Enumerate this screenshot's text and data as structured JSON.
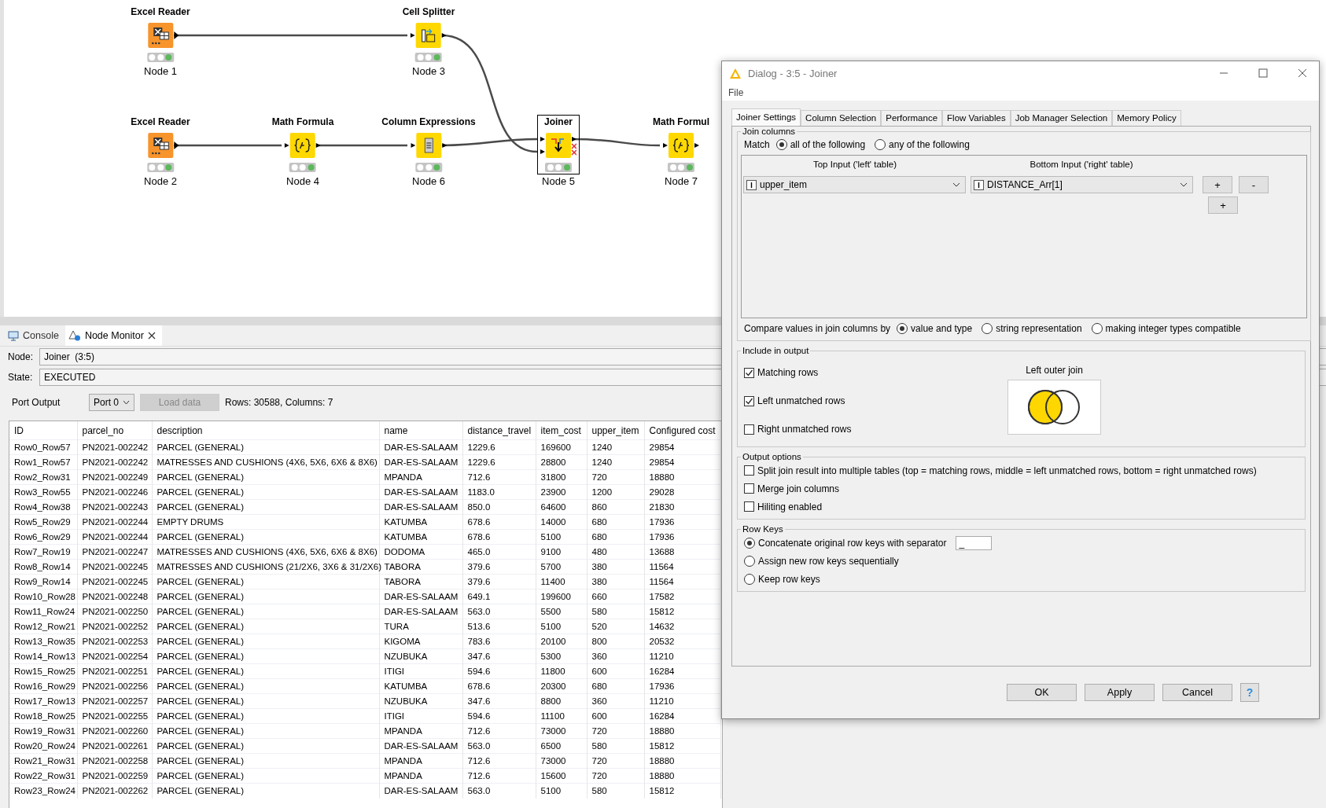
{
  "workflow": {
    "nodes": [
      {
        "title": "Excel Reader",
        "label": "Node 1",
        "kind": "excel",
        "executed": true,
        "selected": false
      },
      {
        "title": "Cell Splitter",
        "label": "Node 3",
        "kind": "splitter",
        "executed": true,
        "selected": false
      },
      {
        "title": "Excel Reader",
        "label": "Node 2",
        "kind": "excel",
        "executed": true,
        "selected": false
      },
      {
        "title": "Math Formula",
        "label": "Node 4",
        "kind": "math",
        "executed": true,
        "selected": false
      },
      {
        "title": "Column Expressions",
        "label": "Node 6",
        "kind": "expr",
        "executed": true,
        "selected": false
      },
      {
        "title": "Joiner",
        "label": "Node 5",
        "kind": "joiner",
        "executed": true,
        "selected": true
      },
      {
        "title": "Math Formul",
        "label": "Node 7",
        "kind": "math",
        "executed": true,
        "selected": false
      }
    ]
  },
  "monitor": {
    "tabs": [
      {
        "label": "Console",
        "kind": "console",
        "selected": false
      },
      {
        "label": "Node Monitor",
        "kind": "monitor",
        "selected": true
      }
    ],
    "node_label": "Node:",
    "node_value": "Joiner  (3:5)",
    "state_label": "State:",
    "state_value": "EXECUTED",
    "port_label": "Port Output",
    "port_select": "Port 0",
    "load_button": {
      "label": "Load data",
      "disabled": true
    },
    "summary": "Rows: 30588, Columns: 7",
    "table": {
      "columns": [
        "ID",
        "parcel_no",
        "description",
        "name",
        "distance_travel",
        "item_cost",
        "upper_item",
        "Configured cost"
      ],
      "rows": [
        [
          "Row0_Row57",
          "PN2021-002242",
          "PARCEL (GENERAL)",
          "DAR-ES-SALAAM",
          "1229.6",
          "169600",
          "1240",
          "29854"
        ],
        [
          "Row1_Row57",
          "PN2021-002242",
          "MATRESSES AND CUSHIONS (4X6, 5X6, 6X6 & 8X6)",
          "DAR-ES-SALAAM",
          "1229.6",
          "28800",
          "1240",
          "29854"
        ],
        [
          "Row2_Row31",
          "PN2021-002249",
          "PARCEL (GENERAL)",
          "MPANDA",
          "712.6",
          "31800",
          "720",
          "18880"
        ],
        [
          "Row3_Row55",
          "PN2021-002246",
          "PARCEL (GENERAL)",
          "DAR-ES-SALAAM",
          "1183.0",
          "23900",
          "1200",
          "29028"
        ],
        [
          "Row4_Row38",
          "PN2021-002243",
          "PARCEL (GENERAL)",
          "DAR-ES-SALAAM",
          "850.0",
          "64600",
          "860",
          "21830"
        ],
        [
          "Row5_Row29",
          "PN2021-002244",
          "EMPTY DRUMS",
          "KATUMBA",
          "678.6",
          "14000",
          "680",
          "17936"
        ],
        [
          "Row6_Row29",
          "PN2021-002244",
          "PARCEL (GENERAL)",
          "KATUMBA",
          "678.6",
          "5100",
          "680",
          "17936"
        ],
        [
          "Row7_Row19",
          "PN2021-002247",
          "MATRESSES AND CUSHIONS (4X6, 5X6, 6X6 & 8X6)",
          "DODOMA",
          "465.0",
          "9100",
          "480",
          "13688"
        ],
        [
          "Row8_Row14",
          "PN2021-002245",
          "MATRESSES AND CUSHIONS (21/2X6, 3X6 & 31/2X6)",
          "TABORA",
          "379.6",
          "5700",
          "380",
          "11564"
        ],
        [
          "Row9_Row14",
          "PN2021-002245",
          "PARCEL (GENERAL)",
          "TABORA",
          "379.6",
          "11400",
          "380",
          "11564"
        ],
        [
          "Row10_Row28",
          "PN2021-002248",
          "PARCEL (GENERAL)",
          "DAR-ES-SALAAM",
          "649.1",
          "199600",
          "660",
          "17582"
        ],
        [
          "Row11_Row24",
          "PN2021-002250",
          "PARCEL (GENERAL)",
          "DAR-ES-SALAAM",
          "563.0",
          "5500",
          "580",
          "15812"
        ],
        [
          "Row12_Row21",
          "PN2021-002252",
          "PARCEL (GENERAL)",
          "TURA",
          "513.6",
          "5100",
          "520",
          "14632"
        ],
        [
          "Row13_Row35",
          "PN2021-002253",
          "PARCEL (GENERAL)",
          "KIGOMA",
          "783.6",
          "20100",
          "800",
          "20532"
        ],
        [
          "Row14_Row13",
          "PN2021-002254",
          "PARCEL (GENERAL)",
          "NZUBUKA",
          "347.6",
          "5300",
          "360",
          "11210"
        ],
        [
          "Row15_Row25",
          "PN2021-002251",
          "PARCEL (GENERAL)",
          "ITIGI",
          "594.6",
          "11800",
          "600",
          "16284"
        ],
        [
          "Row16_Row29",
          "PN2021-002256",
          "PARCEL (GENERAL)",
          "KATUMBA",
          "678.6",
          "20300",
          "680",
          "17936"
        ],
        [
          "Row17_Row13",
          "PN2021-002257",
          "PARCEL (GENERAL)",
          "NZUBUKA",
          "347.6",
          "8800",
          "360",
          "11210"
        ],
        [
          "Row18_Row25",
          "PN2021-002255",
          "PARCEL (GENERAL)",
          "ITIGI",
          "594.6",
          "11100",
          "600",
          "16284"
        ],
        [
          "Row19_Row31",
          "PN2021-002260",
          "PARCEL (GENERAL)",
          "MPANDA",
          "712.6",
          "73000",
          "720",
          "18880"
        ],
        [
          "Row20_Row24",
          "PN2021-002261",
          "PARCEL (GENERAL)",
          "DAR-ES-SALAAM",
          "563.0",
          "6500",
          "580",
          "15812"
        ],
        [
          "Row21_Row31",
          "PN2021-002258",
          "PARCEL (GENERAL)",
          "MPANDA",
          "712.6",
          "73000",
          "720",
          "18880"
        ],
        [
          "Row22_Row31",
          "PN2021-002259",
          "PARCEL (GENERAL)",
          "MPANDA",
          "712.6",
          "15600",
          "720",
          "18880"
        ],
        [
          "Row23_Row24",
          "PN2021-002262",
          "PARCEL (GENERAL)",
          "DAR-ES-SALAAM",
          "563.0",
          "5100",
          "580",
          "15812"
        ]
      ]
    }
  },
  "dialog": {
    "title": "Dialog - 3:5 - Joiner",
    "menu": [
      "File"
    ],
    "tabs": [
      {
        "label": "Joiner Settings",
        "selected": true
      },
      {
        "label": "Column Selection",
        "selected": false
      },
      {
        "label": "Performance",
        "selected": false
      },
      {
        "label": "Flow Variables",
        "selected": false
      },
      {
        "label": "Job Manager Selection",
        "selected": false
      },
      {
        "label": "Memory Policy",
        "selected": false
      }
    ],
    "join_columns": {
      "legend": "Join columns",
      "match_label": "Match",
      "match_options": [
        {
          "label": "all of the following",
          "selected": true
        },
        {
          "label": "any of the following",
          "selected": false
        }
      ],
      "headers": [
        "Top Input ('left' table)",
        "Bottom Input ('right' table)"
      ],
      "rows": [
        {
          "left": "upper_item",
          "right": "DISTANCE_Arr[1]"
        }
      ],
      "row_buttons": [
        "+",
        "-"
      ],
      "add_button": "+",
      "compare_label": "Compare values in join columns by",
      "compare_options": [
        {
          "label": "value and type",
          "selected": true
        },
        {
          "label": "string representation",
          "selected": false
        },
        {
          "label": "making integer types compatible",
          "selected": false
        }
      ]
    },
    "include_output": {
      "legend": "Include in output",
      "options": [
        {
          "label": "Matching rows",
          "checked": true
        },
        {
          "label": "Left unmatched rows",
          "checked": true
        },
        {
          "label": "Right unmatched rows",
          "checked": false
        }
      ],
      "venn_label": "Left outer join"
    },
    "output_options": {
      "legend": "Output options",
      "options": [
        {
          "label": "Split join result into multiple tables (top = matching rows, middle = left unmatched rows, bottom = right unmatched rows)",
          "checked": false
        },
        {
          "label": "Merge join columns",
          "checked": false
        },
        {
          "label": "Hiliting enabled",
          "checked": false
        }
      ]
    },
    "row_keys": {
      "legend": "Row Keys",
      "options": [
        {
          "label": "Concatenate original row keys with separator",
          "selected": true,
          "separator": "_"
        },
        {
          "label": "Assign new row keys sequentially",
          "selected": false
        },
        {
          "label": "Keep row keys",
          "selected": false
        }
      ]
    },
    "buttons": [
      "OK",
      "Apply",
      "Cancel"
    ],
    "help_button": "?"
  }
}
